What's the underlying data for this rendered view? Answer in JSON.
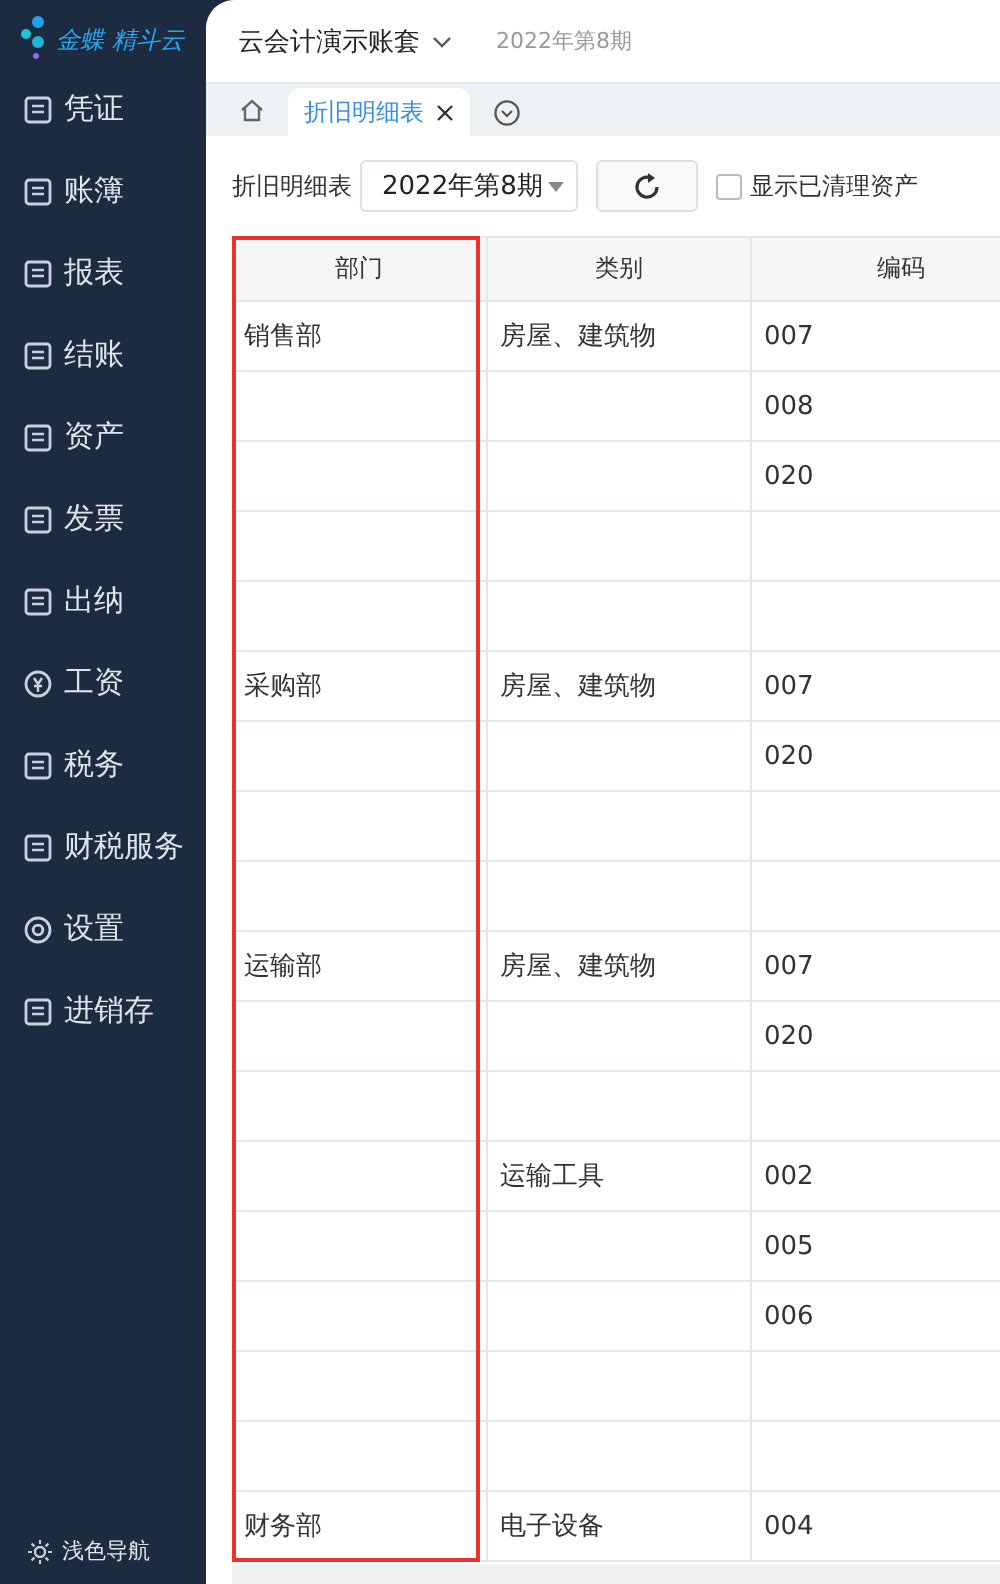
{
  "logo": {
    "text": "金蝶 精斗云"
  },
  "sidebar": {
    "items": [
      {
        "label": "凭证"
      },
      {
        "label": "账簿"
      },
      {
        "label": "报表"
      },
      {
        "label": "结账"
      },
      {
        "label": "资产"
      },
      {
        "label": "发票"
      },
      {
        "label": "出纳"
      },
      {
        "label": "工资"
      },
      {
        "label": "税务"
      },
      {
        "label": "财税服务"
      },
      {
        "label": "设置"
      },
      {
        "label": "进销存"
      }
    ],
    "footer": "浅色导航"
  },
  "header": {
    "account": "云会计演示账套",
    "period": "2022年第8期"
  },
  "tabs": [
    {
      "label": "折旧明细表",
      "selected": true
    }
  ],
  "toolbar": {
    "label": "折旧明细表",
    "period": "2022年第8期",
    "checkbox": {
      "label": "显示已清理资产",
      "checked": false
    }
  },
  "table": {
    "columns": [
      {
        "label": "部门",
        "highlighted": true
      },
      {
        "label": "类别",
        "highlighted": false
      },
      {
        "label": "编码",
        "highlighted": false
      }
    ],
    "rows": [
      {
        "dept": "销售部",
        "category": "房屋、建筑物",
        "code": "007"
      },
      {
        "code": "008"
      },
      {
        "code": "020"
      },
      {},
      {},
      {
        "dept": "采购部",
        "category": "房屋、建筑物",
        "code": "007"
      },
      {
        "code": "020"
      },
      {},
      {},
      {
        "dept": "运输部",
        "category": "房屋、建筑物",
        "code": "007"
      },
      {
        "code": "020"
      },
      {},
      {
        "category": "运输工具",
        "code": "002"
      },
      {
        "code": "005"
      },
      {
        "code": "006"
      },
      {},
      {},
      {
        "dept": "财务部",
        "category": "电子设备",
        "code": "004"
      }
    ]
  }
}
